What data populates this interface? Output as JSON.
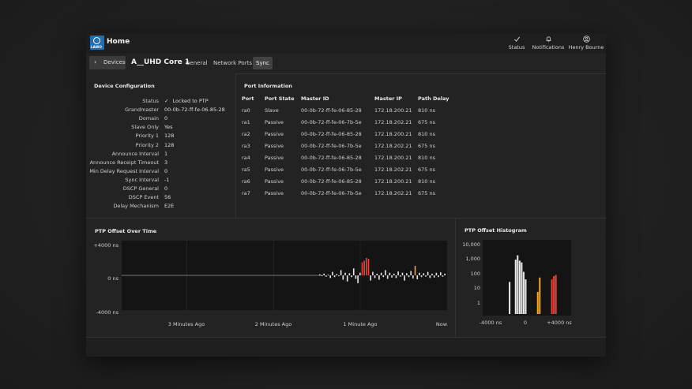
{
  "app": {
    "title": "Home",
    "logo_text": "LAWO"
  },
  "header": {
    "buttons": [
      {
        "id": "status",
        "label": "Status",
        "icon": "check-icon"
      },
      {
        "id": "notifications",
        "label": "Notifications",
        "icon": "bell-icon"
      },
      {
        "id": "user",
        "label": "Henry Bourne",
        "icon": "user-icon"
      }
    ]
  },
  "toolbar": {
    "back_label": "Devices",
    "device_title": "A__UHD Core 1",
    "tabs": [
      {
        "label": "General",
        "active": false
      },
      {
        "label": "Network Ports",
        "active": false
      },
      {
        "label": "Sync",
        "active": true
      }
    ]
  },
  "device_config": {
    "title": "Device Configuration",
    "rows": [
      {
        "key": "Status",
        "value": "Locked to PTP",
        "icon": "check-icon"
      },
      {
        "key": "Grandmaster",
        "value": "00-0b-72-ff-fe-06-85-28"
      },
      {
        "key": "Domain",
        "value": "0"
      },
      {
        "key": "Slave Only",
        "value": "Yes"
      },
      {
        "key": "Priority 1",
        "value": "128"
      },
      {
        "key": "Priority 2",
        "value": "128"
      },
      {
        "key": "Announce Interval",
        "value": "1"
      },
      {
        "key": "Announce Receipt Timeout",
        "value": "3"
      },
      {
        "key": "Min Delay Request Interval",
        "value": "0"
      },
      {
        "key": "Sync Interval",
        "value": "-1"
      },
      {
        "key": "DSCP General",
        "value": "0"
      },
      {
        "key": "DSCP Event",
        "value": "56"
      },
      {
        "key": "Delay Mechanism",
        "value": "E2E"
      }
    ]
  },
  "port_info": {
    "title": "Port Information",
    "columns": [
      "Port",
      "Port State",
      "Master ID",
      "Master IP",
      "Path Delay"
    ],
    "rows": [
      [
        "ra0",
        "Slave",
        "00-0b-72-ff-fe-06-85-28",
        "172.18.200.21",
        "810 ns"
      ],
      [
        "ra1",
        "Passive",
        "00-0b-72-ff-fe-06-7b-5e",
        "172.18.202.21",
        "675 ns"
      ],
      [
        "ra2",
        "Passive",
        "00-0b-72-ff-fe-06-85-28",
        "172.18.200.21",
        "810 ns"
      ],
      [
        "ra3",
        "Passive",
        "00-0b-72-ff-fe-06-7b-5e",
        "172.18.202.21",
        "675 ns"
      ],
      [
        "ra4",
        "Passive",
        "00-0b-72-ff-fe-06-85-28",
        "172.18.200.21",
        "810 ns"
      ],
      [
        "ra5",
        "Passive",
        "00-0b-72-ff-fe-06-7b-5e",
        "172.18.202.21",
        "675 ns"
      ],
      [
        "ra6",
        "Passive",
        "00-0b-72-ff-fe-06-85-28",
        "172.18.200.21",
        "810 ns"
      ],
      [
        "ra7",
        "Passive",
        "00-0b-72-ff-fe-06-7b-5e",
        "172.18.202.21",
        "675 ns"
      ]
    ]
  },
  "chart_data": [
    {
      "type": "bar",
      "title": "PTP Offset Over Time",
      "ylim": [
        -4000,
        4000
      ],
      "y_ticks": [
        "+4000 ns",
        "0 ns",
        "-4000 ns"
      ],
      "x_ticks": [
        "3 Minutes Ago",
        "2 Minutes Ago",
        "1 Minute Ago",
        "Now"
      ],
      "colors": {
        "normal": "#e8e8e8",
        "warning": "#f5a623",
        "alarm": "#e8433a",
        "plot_bg": "#141414",
        "grid": "#2c2c2c"
      },
      "flat_until_index": 0,
      "series": [
        {
          "values": [
            120,
            -80,
            200,
            -150,
            90,
            -300,
            400,
            -200,
            150,
            -100,
            600,
            -500,
            300,
            -700,
            250,
            -200,
            800,
            -400,
            -900,
            300,
            1500,
            1700,
            2000,
            1900,
            -600,
            400,
            -300,
            200,
            -500,
            300,
            -200,
            600,
            -400,
            300,
            -250,
            200,
            -300,
            450,
            -150,
            300,
            -600,
            250,
            -200,
            500,
            -350,
            1100,
            -450,
            300,
            -200,
            250,
            -150,
            400,
            -300,
            200,
            -250,
            300,
            -200,
            350,
            -150,
            200
          ],
          "status": [
            "n",
            "n",
            "n",
            "n",
            "n",
            "n",
            "n",
            "n",
            "n",
            "n",
            "n",
            "n",
            "n",
            "n",
            "n",
            "n",
            "n",
            "n",
            "n",
            "n",
            "a",
            "a",
            "a",
            "a",
            "n",
            "n",
            "n",
            "n",
            "n",
            "n",
            "n",
            "n",
            "n",
            "n",
            "n",
            "n",
            "n",
            "n",
            "n",
            "n",
            "n",
            "n",
            "n",
            "n",
            "n",
            "w",
            "n",
            "n",
            "n",
            "n",
            "n",
            "n",
            "n",
            "n",
            "n",
            "n",
            "n",
            "n",
            "n",
            "n"
          ]
        }
      ]
    },
    {
      "type": "bar",
      "title": "PTP Offset Histogram",
      "y_scale": "log",
      "y_ticks": [
        "10,000",
        "1,000",
        "100",
        "10",
        "1"
      ],
      "x_ticks": [
        "-4000 ns",
        "0",
        "+4000 ns"
      ],
      "colors": {
        "normal": "#e8e8e8",
        "warning": "#f5a623",
        "alarm": "#e8433a",
        "plot_bg": "#141414",
        "grid": "#2c2c2c"
      },
      "series": [
        {
          "values": [
            0,
            0,
            0,
            0,
            0,
            0,
            0,
            0,
            0,
            0,
            0,
            0,
            0,
            20,
            0,
            0,
            700,
            1400,
            600,
            450,
            100,
            30,
            0,
            0,
            0,
            0,
            0,
            4,
            40,
            0,
            0,
            0,
            0,
            0,
            30,
            50,
            60,
            0,
            0,
            0,
            0,
            0,
            0,
            0
          ],
          "status": [
            "n",
            "n",
            "n",
            "n",
            "n",
            "n",
            "n",
            "n",
            "n",
            "n",
            "n",
            "n",
            "n",
            "n",
            "n",
            "n",
            "n",
            "n",
            "n",
            "n",
            "n",
            "n",
            "n",
            "n",
            "n",
            "n",
            "n",
            "w",
            "w",
            "n",
            "n",
            "n",
            "n",
            "n",
            "a",
            "a",
            "a",
            "n",
            "n",
            "n",
            "n",
            "n",
            "n",
            "n"
          ]
        }
      ]
    }
  ]
}
